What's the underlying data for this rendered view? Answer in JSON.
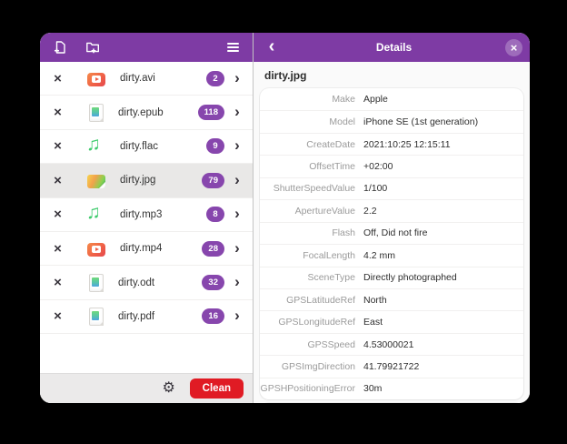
{
  "header": {
    "icons": {
      "add_file": "add-file-icon",
      "add_folder": "add-folder-icon",
      "menu": "menu-icon",
      "back": "back-icon",
      "close": "close-icon",
      "gear": "gear-icon"
    }
  },
  "files": [
    {
      "name": "dirty.avi",
      "count": "2",
      "type": "video"
    },
    {
      "name": "dirty.epub",
      "count": "118",
      "type": "document"
    },
    {
      "name": "dirty.flac",
      "count": "9",
      "type": "audio"
    },
    {
      "name": "dirty.jpg",
      "count": "79",
      "type": "image",
      "selected": true
    },
    {
      "name": "dirty.mp3",
      "count": "8",
      "type": "audio"
    },
    {
      "name": "dirty.mp4",
      "count": "28",
      "type": "video"
    },
    {
      "name": "dirty.odt",
      "count": "32",
      "type": "document"
    },
    {
      "name": "dirty.pdf",
      "count": "16",
      "type": "document"
    }
  ],
  "footer": {
    "clean_label": "Clean"
  },
  "details": {
    "title": "Details",
    "file_title": "dirty.jpg",
    "rows": [
      {
        "key": "Make",
        "value": "Apple"
      },
      {
        "key": "Model",
        "value": "iPhone SE (1st generation)"
      },
      {
        "key": "CreateDate",
        "value": "2021:10:25 12:15:11"
      },
      {
        "key": "OffsetTime",
        "value": "+02:00"
      },
      {
        "key": "ShutterSpeedValue",
        "value": "1/100"
      },
      {
        "key": "ApertureValue",
        "value": "2.2"
      },
      {
        "key": "Flash",
        "value": "Off, Did not fire"
      },
      {
        "key": "FocalLength",
        "value": "4.2 mm"
      },
      {
        "key": "SceneType",
        "value": "Directly photographed"
      },
      {
        "key": "GPSLatitudeRef",
        "value": "North"
      },
      {
        "key": "GPSLongitudeRef",
        "value": "East"
      },
      {
        "key": "GPSSpeed",
        "value": "4.53000021"
      },
      {
        "key": "GPSImgDirection",
        "value": "41.79921722"
      },
      {
        "key": "GPSHPositioningError",
        "value": "30m"
      }
    ]
  },
  "colors": {
    "header_purple": "#7e3ba4",
    "badge_purple": "#8746ad",
    "clean_red": "#e01b24",
    "audio_green": "#3ecb6c"
  }
}
